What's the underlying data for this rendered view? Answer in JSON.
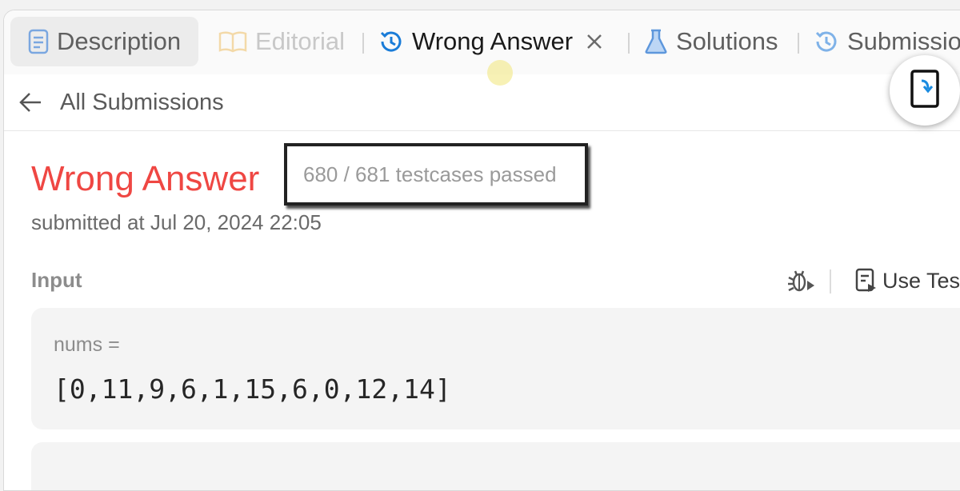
{
  "tabs": {
    "description": "Description",
    "editorial": "Editorial",
    "wrong_answer": "Wrong Answer",
    "solutions": "Solutions",
    "submissions": "Submissio"
  },
  "back_link": "All Submissions",
  "result": {
    "status": "Wrong Answer",
    "testcases": "680 / 681 testcases passed",
    "submitted_at": "submitted at Jul 20, 2024 22:05"
  },
  "input": {
    "label": "Input",
    "use_testcase": "Use Testc",
    "var_name": "nums =",
    "var_value": "[0,11,9,6,1,15,6,0,12,14]"
  },
  "colors": {
    "status_red": "#ef4743",
    "accent_blue": "#1a7cd8"
  },
  "icons": [
    "description-icon",
    "book-icon",
    "history-icon",
    "close-icon",
    "flask-icon",
    "back-arrow-icon",
    "tablet-rotate-icon",
    "debug-icon",
    "use-testcase-icon"
  ]
}
